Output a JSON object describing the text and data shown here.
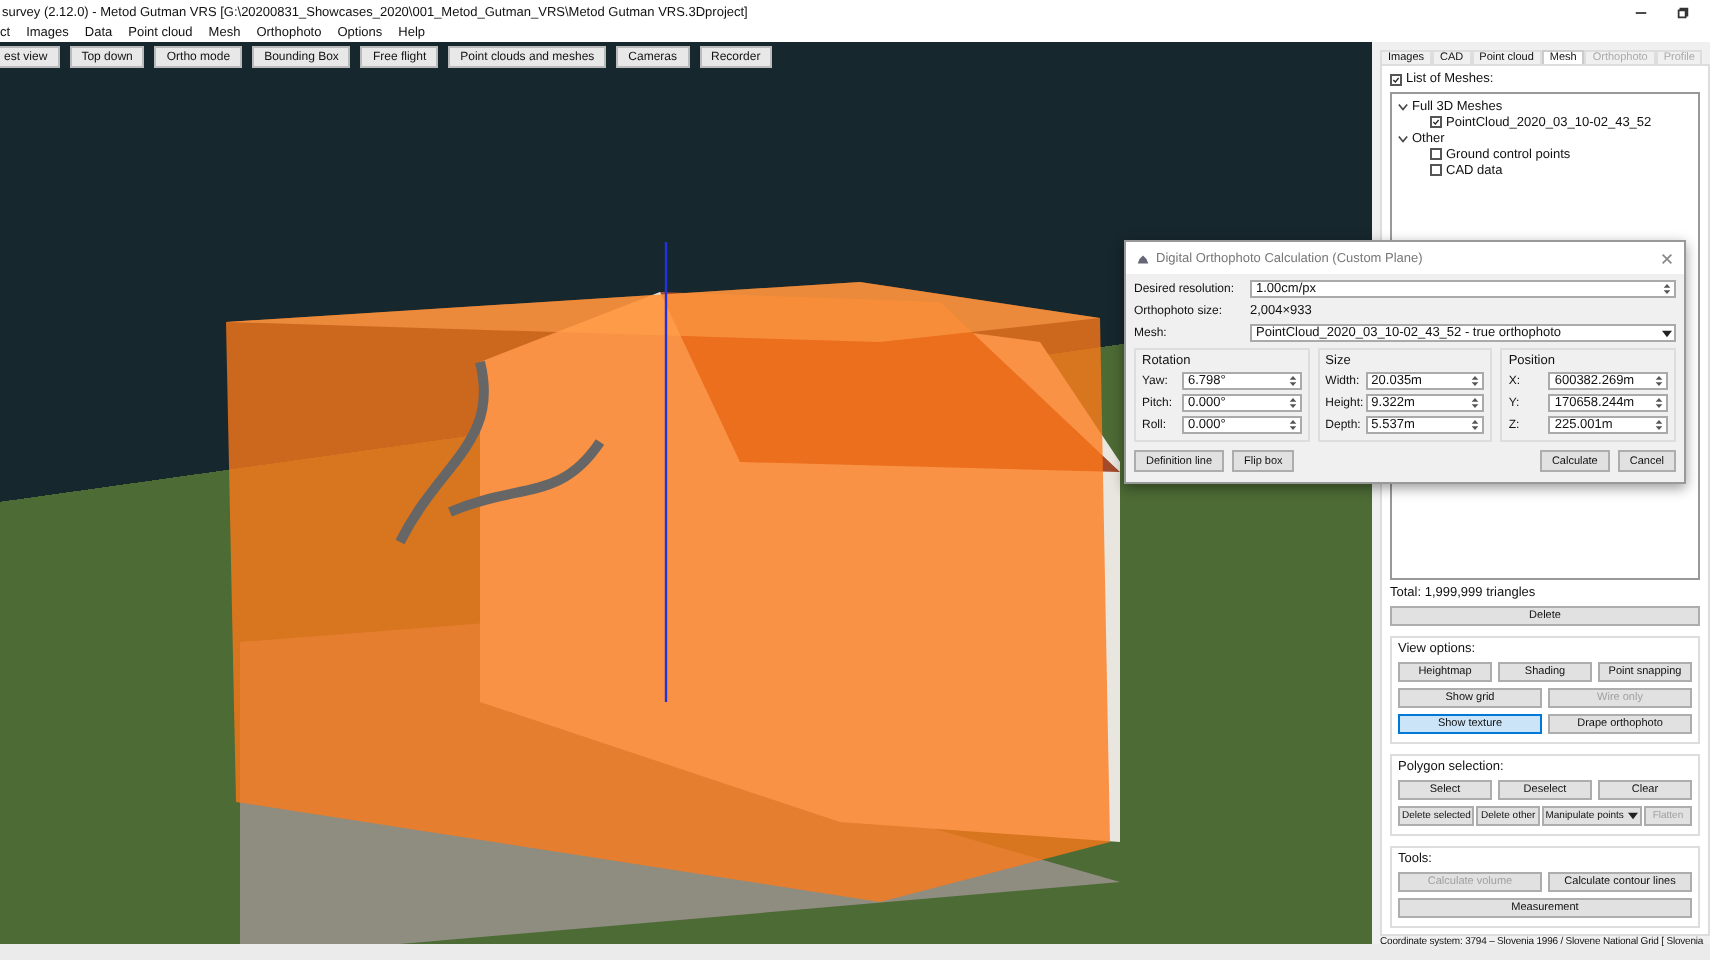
{
  "window": {
    "title": "survey (2.12.0) - Metod Gutman VRS [G:\\20200831_Showcases_2020\\001_Metod_Gutman_VRS\\Metod Gutman VRS.3Dproject]"
  },
  "menu": [
    "ct",
    "Images",
    "Data",
    "Point cloud",
    "Mesh",
    "Orthophoto",
    "Options",
    "Help"
  ],
  "toolbar": [
    "est view",
    "Top down",
    "Ortho mode",
    "Bounding Box",
    "Free flight",
    "Point clouds and meshes",
    "Cameras",
    "Recorder"
  ],
  "panel": {
    "tabs": [
      {
        "label": "Images",
        "selected": false,
        "disabled": false
      },
      {
        "label": "CAD",
        "selected": false,
        "disabled": false
      },
      {
        "label": "Point cloud",
        "selected": false,
        "disabled": false
      },
      {
        "label": "Mesh",
        "selected": true,
        "disabled": false
      },
      {
        "label": "Orthophoto",
        "selected": false,
        "disabled": true
      },
      {
        "label": "Profile",
        "selected": false,
        "disabled": true
      }
    ],
    "list_toggle": {
      "label": "List of Meshes:",
      "checked": true
    },
    "tree": [
      {
        "label": "Full 3D Meshes",
        "expanded": true,
        "children": [
          {
            "label": "PointCloud_2020_03_10-02_43_52",
            "checked": true
          }
        ]
      },
      {
        "label": "Other",
        "expanded": true,
        "children": [
          {
            "label": "Ground control points",
            "checked": false
          },
          {
            "label": "CAD data",
            "checked": false
          }
        ]
      }
    ],
    "total": "Total: 1,999,999 triangles",
    "delete_button": "Delete",
    "groups": [
      {
        "title": "View options:",
        "rows": [
          [
            {
              "label": "Heightmap",
              "kind": "push",
              "selected": false,
              "disabled": false
            },
            {
              "label": "Shading",
              "kind": "push",
              "selected": false,
              "disabled": false
            },
            {
              "label": "Point snapping",
              "kind": "push",
              "selected": false,
              "disabled": false
            }
          ],
          [
            {
              "label": "Show grid",
              "kind": "push",
              "selected": false,
              "disabled": false
            },
            {
              "label": "Wire only",
              "kind": "push",
              "selected": false,
              "disabled": true
            }
          ],
          [
            {
              "label": "Show texture",
              "kind": "push",
              "selected": true,
              "disabled": false
            },
            {
              "label": "Drape orthophoto",
              "kind": "push",
              "selected": false,
              "disabled": false
            }
          ]
        ]
      },
      {
        "title": "Polygon selection:",
        "rows": [
          [
            {
              "label": "Select",
              "kind": "push",
              "selected": false,
              "disabled": false
            },
            {
              "label": "Deselect",
              "kind": "push",
              "selected": false,
              "disabled": false
            },
            {
              "label": "Clear",
              "kind": "push",
              "selected": false,
              "disabled": false
            }
          ],
          [
            {
              "label": "Delete selected",
              "kind": "push",
              "selected": false,
              "disabled": false
            },
            {
              "label": "Delete other",
              "kind": "push",
              "selected": false,
              "disabled": false
            },
            {
              "label": "Manipulate points",
              "kind": "menu",
              "selected": false,
              "disabled": false
            },
            {
              "label": "Flatten",
              "kind": "push",
              "selected": false,
              "disabled": true
            }
          ]
        ]
      },
      {
        "title": "Tools:",
        "rows": [
          [
            {
              "label": "Calculate volume",
              "kind": "push",
              "selected": false,
              "disabled": true
            },
            {
              "label": "Calculate contour lines",
              "kind": "push",
              "selected": false,
              "disabled": false
            }
          ],
          [
            {
              "label": "Measurement",
              "kind": "push",
              "selected": false,
              "disabled": false
            }
          ]
        ]
      }
    ],
    "status": "Coordinate system: 3794 – Slovenia 1996 / Slovene National Grid [ Slovenia"
  },
  "dialog": {
    "title": "Digital Orthophoto Calculation (Custom Plane)",
    "resolution": {
      "label": "Desired resolution:",
      "value": "1.00cm/px"
    },
    "size": {
      "label": "Orthophoto size:",
      "value": "2,004×933"
    },
    "mesh": {
      "label": "Mesh:",
      "value": "PointCloud_2020_03_10-02_43_52 - true orthophoto"
    },
    "groups": [
      {
        "title": "Rotation",
        "fields": [
          {
            "label": "Yaw:",
            "value": "6.798°"
          },
          {
            "label": "Pitch:",
            "value": "0.000°"
          },
          {
            "label": "Roll:",
            "value": "0.000°"
          }
        ]
      },
      {
        "title": "Size",
        "fields": [
          {
            "label": "Width:",
            "value": "20.035m"
          },
          {
            "label": "Height:",
            "value": "9.322m"
          },
          {
            "label": "Depth:",
            "value": "5.537m"
          }
        ]
      },
      {
        "title": "Position",
        "fields": [
          {
            "label": "X:",
            "value": "600382.269m"
          },
          {
            "label": "Y:",
            "value": "170658.244m"
          },
          {
            "label": "Z:",
            "value": "225.001m"
          }
        ]
      }
    ],
    "buttons_left": [
      "Definition line",
      "Flip box"
    ],
    "buttons_right": [
      "Calculate",
      "Cancel"
    ]
  }
}
